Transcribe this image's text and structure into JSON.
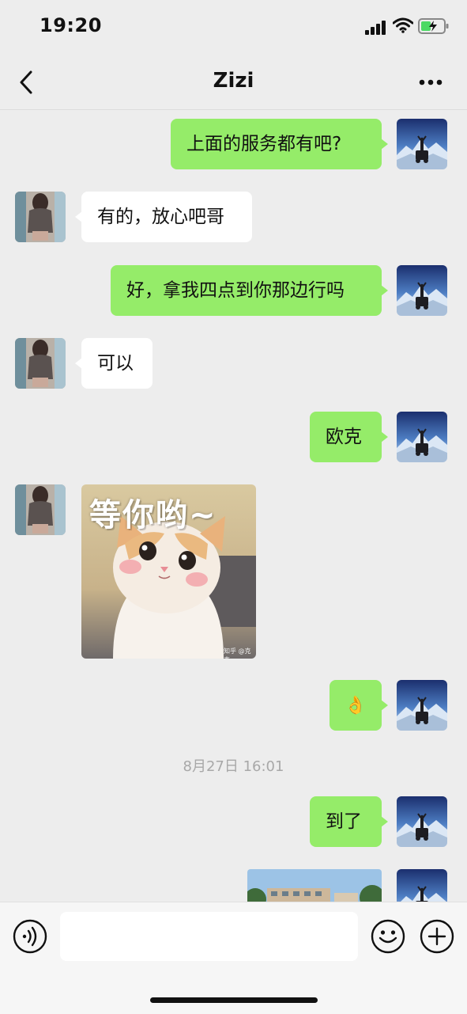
{
  "status_bar": {
    "time": "19:20"
  },
  "header": {
    "title": "Zizi"
  },
  "messages": [
    {
      "side": "out",
      "text": "上面的服务都有吧?"
    },
    {
      "side": "in",
      "text": "有的，放心吧哥"
    },
    {
      "side": "out",
      "text": "好，拿我四点到你那边行吗"
    },
    {
      "side": "in",
      "text": "可以"
    },
    {
      "side": "out",
      "text": "欧克"
    },
    {
      "side": "in",
      "sticker_text": "等你哟~",
      "sticker_credit": "知乎 @克克"
    },
    {
      "side": "out",
      "emoji": "👌"
    },
    {
      "side": "out",
      "text": "到了"
    }
  ],
  "timestamp": "8月27日 16:01",
  "input_bar": {
    "placeholder": ""
  },
  "colors": {
    "out_bubble": "#95ec69",
    "in_bubble": "#ffffff",
    "background": "#ededed"
  }
}
